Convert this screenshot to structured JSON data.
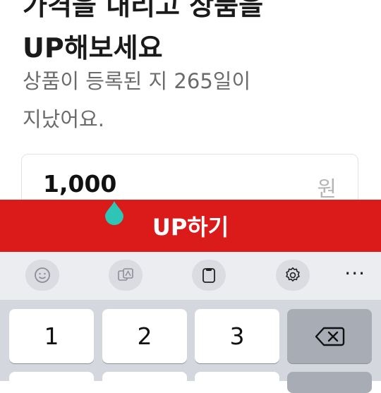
{
  "headline": {
    "line1": "가격을 내리고 상품을",
    "line2": "UP해보세요"
  },
  "subtext": {
    "line1": "상품이 등록된 지 265일이",
    "line2": "지났어요."
  },
  "price_field": {
    "value": "1,000",
    "unit": "원"
  },
  "up_button": {
    "label": "UP하기"
  },
  "colors": {
    "accent": "#db1a1a",
    "cursor_handle": "#2ec4b6"
  },
  "keyboard": {
    "toolbar": [
      {
        "icon": "emoji-icon"
      },
      {
        "icon": "translate-icon"
      },
      {
        "icon": "clipboard-icon"
      },
      {
        "icon": "settings-icon"
      },
      {
        "icon": "more-icon",
        "label": "···"
      }
    ],
    "keys": [
      "1",
      "2",
      "3"
    ],
    "backspace_icon": "backspace-icon"
  }
}
